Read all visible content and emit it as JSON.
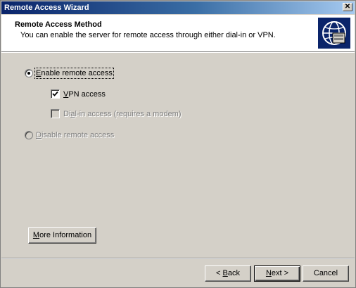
{
  "window": {
    "title": "Remote Access Wizard",
    "close_glyph": "✕"
  },
  "header": {
    "title": "Remote Access Method",
    "subtitle": "You can enable the server for remote access through either dial-in or VPN.",
    "icon": "globe-server-icon"
  },
  "options": {
    "enable_remote": {
      "label_key": "E",
      "label_rest": "nable remote access",
      "checked": true
    },
    "vpn": {
      "label_key": "V",
      "label_rest": "PN access",
      "checked": true
    },
    "dialin": {
      "label_pre": "Di",
      "label_key": "a",
      "label_rest": "l-in access (requires a modem)",
      "checked": false,
      "disabled": true
    },
    "disable_remote": {
      "label_key": "D",
      "label_rest": "isable remote access",
      "checked": false,
      "disabled": true
    }
  },
  "buttons": {
    "more_info": {
      "key": "M",
      "rest": "ore Information"
    },
    "back": {
      "pre": "< ",
      "key": "B",
      "rest": "ack"
    },
    "next": {
      "key": "N",
      "rest": "ext >"
    },
    "cancel": {
      "label": "Cancel"
    }
  },
  "colors": {
    "titlebar_start": "#0a246a",
    "titlebar_end": "#a6caf0",
    "face": "#d4d0c8"
  }
}
